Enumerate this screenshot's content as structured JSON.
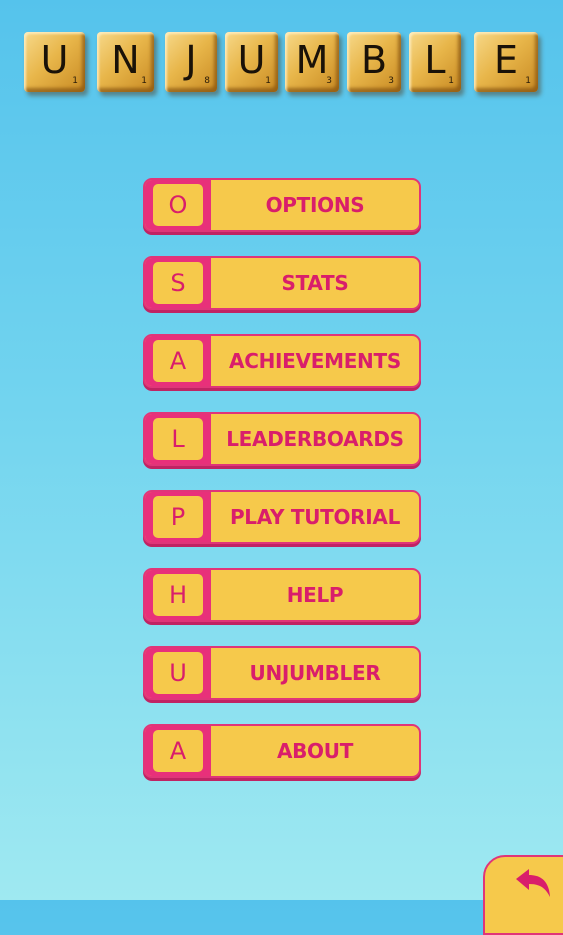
{
  "title": {
    "tiles": [
      {
        "letter": "U",
        "score": "1"
      },
      {
        "letter": "N",
        "score": "1"
      },
      {
        "letter": "J",
        "score": "8"
      },
      {
        "letter": "U",
        "score": "1"
      },
      {
        "letter": "M",
        "score": "3"
      },
      {
        "letter": "B",
        "score": "3"
      },
      {
        "letter": "L",
        "score": "1"
      },
      {
        "letter": "E",
        "score": "1"
      }
    ]
  },
  "menu": {
    "items": [
      {
        "letter": "O",
        "label": "OPTIONS"
      },
      {
        "letter": "S",
        "label": "STATS"
      },
      {
        "letter": "A",
        "label": "ACHIEVEMENTS"
      },
      {
        "letter": "L",
        "label": "LEADERBOARDS"
      },
      {
        "letter": "P",
        "label": "PLAY TUTORIAL"
      },
      {
        "letter": "H",
        "label": "HELP"
      },
      {
        "letter": "U",
        "label": "UNJUMBLER"
      },
      {
        "letter": "A",
        "label": "ABOUT"
      }
    ]
  },
  "back_button": {
    "icon": "back-arrow-icon"
  },
  "colors": {
    "button_fill": "#f6c94b",
    "button_accent": "#e8307a",
    "label_text": "#d91e6b",
    "tile_wood": "#e8b64a"
  }
}
